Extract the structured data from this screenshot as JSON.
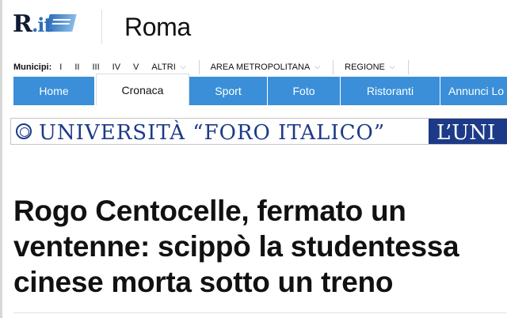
{
  "header": {
    "logo": {
      "main": "R",
      "suffix": ".it"
    },
    "city": "Roma"
  },
  "subnav": {
    "label": "Municipi:",
    "items": [
      "I",
      "II",
      "III",
      "IV",
      "V",
      "ALTRI"
    ],
    "area": "AREA METROPOLITANA",
    "region": "REGIONE"
  },
  "mainnav": {
    "tabs": [
      "Home",
      "Cronaca",
      "Sport",
      "Foto",
      "Ristoranti",
      "Annunci Lo"
    ],
    "active": "Cronaca"
  },
  "banner": {
    "text": "UNIVERSITÀ “FORO ITALICO”",
    "right_text": "L’UNI",
    "colors": {
      "primary": "#1c3a87"
    }
  },
  "article": {
    "headline": "Rogo Centocelle, fermato un ventenne: scippò la studentessa cinese morta sotto un treno"
  },
  "colors": {
    "nav_blue": "#3a8fd8"
  }
}
